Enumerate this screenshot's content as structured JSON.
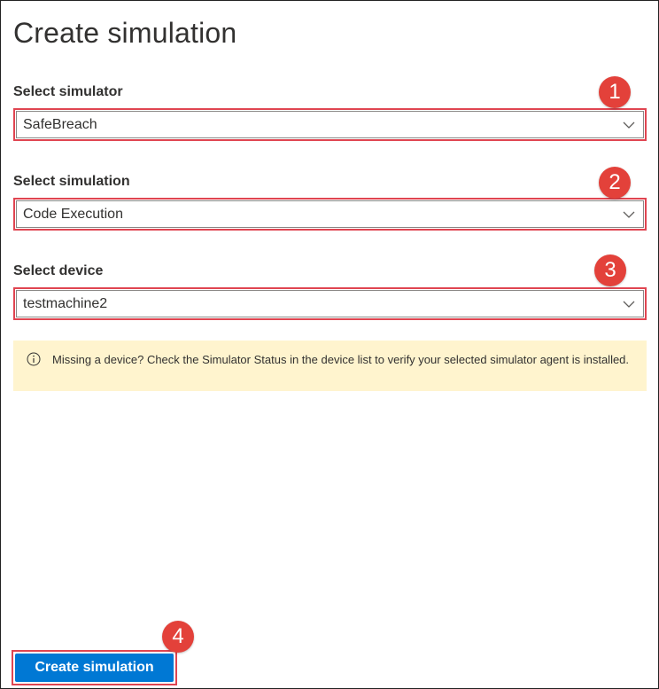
{
  "panel": {
    "title": "Create simulation"
  },
  "fields": {
    "simulator": {
      "label": "Select simulator",
      "value": "SafeBreach",
      "callout": "1"
    },
    "simulation": {
      "label": "Select simulation",
      "value": "Code Execution",
      "callout": "2"
    },
    "device": {
      "label": "Select device",
      "value": "testmachine2",
      "callout": "3"
    }
  },
  "notice": {
    "icon": "info-icon",
    "text": "Missing a device? Check the Simulator Status in the device list to verify your selected simulator agent is installed."
  },
  "footer": {
    "create_label": "Create simulation",
    "callout": "4"
  },
  "colors": {
    "accent": "#0078d4",
    "highlight": "#e04551",
    "callout": "#e3413a",
    "notice_bg": "#fff4ce"
  }
}
